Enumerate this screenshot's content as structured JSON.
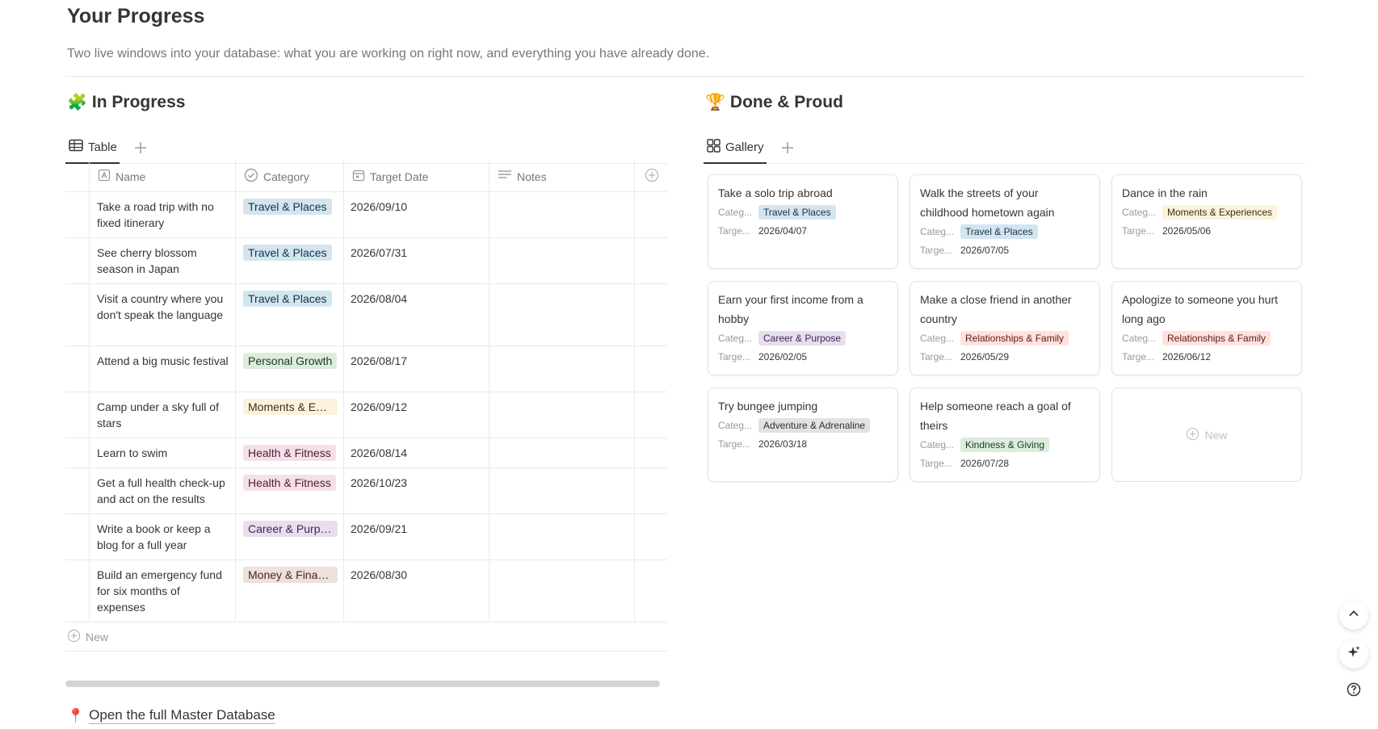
{
  "page": {
    "title": "Your Progress",
    "description": "Two live windows into your database: what you are working on right now, and everything you have already done."
  },
  "in_progress": {
    "emoji": "🧩",
    "title": "In Progress",
    "tab_label": "Table",
    "columns": {
      "name": "Name",
      "category": "Category",
      "target_date": "Target Date",
      "notes": "Notes"
    },
    "rows": [
      {
        "name": "Take a road trip with no fixed itinerary",
        "category": "Travel & Places",
        "cat_color": "blue",
        "date": "2026/09/10",
        "h": 57
      },
      {
        "name": "See cherry blossom season in Japan",
        "category": "Travel & Places",
        "cat_color": "blue",
        "date": "2026/07/31",
        "h": 57
      },
      {
        "name": "Visit a country where you don't speak the language",
        "category": "Travel & Places",
        "cat_color": "blue",
        "date": "2026/08/04",
        "h": 77
      },
      {
        "name": "Attend a big music festival",
        "category": "Personal Growth",
        "cat_color": "green",
        "date": "2026/08/17",
        "h": 57
      },
      {
        "name": "Camp under a sky full of stars",
        "category": "Moments & Experiences",
        "cat_color": "yellow",
        "date": "2026/09/12",
        "h": 57
      },
      {
        "name": "Learn to swim",
        "category": "Health & Fitness",
        "cat_color": "pink",
        "date": "2026/08/14",
        "h": 37
      },
      {
        "name": "Get a full health check-up and act on the results",
        "category": "Health & Fitness",
        "cat_color": "pink",
        "date": "2026/10/23",
        "h": 57
      },
      {
        "name": "Write a book or keep a blog for a full year",
        "category": "Career & Purpose",
        "cat_color": "purple",
        "date": "2026/09/21",
        "h": 57
      },
      {
        "name": "Build an emergency fund for six months of expenses",
        "category": "Money & Finance",
        "cat_color": "tan",
        "date": "2026/08/30",
        "h": 77
      }
    ],
    "new_label": "New"
  },
  "done": {
    "emoji": "🏆",
    "title": "Done & Proud",
    "tab_label": "Gallery",
    "prop_category": "Categ...",
    "prop_target": "Targe...",
    "cards": [
      {
        "title": "Take a solo trip abroad",
        "category": "Travel & Places",
        "cat_color": "blue",
        "date": "2026/04/07"
      },
      {
        "title": "Walk the streets of your childhood hometown again",
        "category": "Travel & Places",
        "cat_color": "blue",
        "date": "2026/07/05"
      },
      {
        "title": "Dance in the rain",
        "category": "Moments & Experiences",
        "cat_color": "yellow",
        "date": "2026/05/06"
      },
      {
        "title": "Earn your first income from a hobby",
        "category": "Career & Purpose",
        "cat_color": "purple",
        "date": "2026/02/05"
      },
      {
        "title": "Make a close friend in another country",
        "category": "Relationships & Family",
        "cat_color": "red",
        "date": "2026/05/29"
      },
      {
        "title": "Apologize to someone you hurt long ago",
        "category": "Relationships & Family",
        "cat_color": "red",
        "date": "2026/06/12"
      },
      {
        "title": "Try bungee jumping",
        "category": "Adventure & Adrenaline",
        "cat_color": "gray",
        "date": "2026/03/18"
      },
      {
        "title": "Help someone reach a goal of theirs",
        "category": "Kindness & Giving",
        "cat_color": "green",
        "date": "2026/07/28"
      }
    ],
    "new_label": "New"
  },
  "link": {
    "emoji": "📍",
    "label": "Open the full Master Database"
  },
  "tag_colors": {
    "blue": {
      "bg": "#d3e5ef",
      "fg": "#183347"
    },
    "green": {
      "bg": "#dbeddb",
      "fg": "#1c3829"
    },
    "yellow": {
      "bg": "#fbf3db",
      "fg": "#402c1b"
    },
    "pink": {
      "bg": "#f5e0e9",
      "fg": "#4c2337"
    },
    "purple": {
      "bg": "#e8deee",
      "fg": "#412454"
    },
    "tan": {
      "bg": "#eee0da",
      "fg": "#442a1e"
    },
    "red": {
      "bg": "#ffe2dd",
      "fg": "#5d1715"
    },
    "gray": {
      "bg": "#e3e2e0",
      "fg": "#32302c"
    }
  },
  "icons": {
    "table_tab": "table-icon",
    "gallery_tab": "gallery-icon",
    "name_col": "text-property-icon",
    "category_col": "status-property-icon",
    "date_col": "calendar-icon",
    "notes_col": "lines-icon",
    "floating": [
      "chevron-up-icon",
      "sparkle-icon",
      "help-icon"
    ]
  }
}
